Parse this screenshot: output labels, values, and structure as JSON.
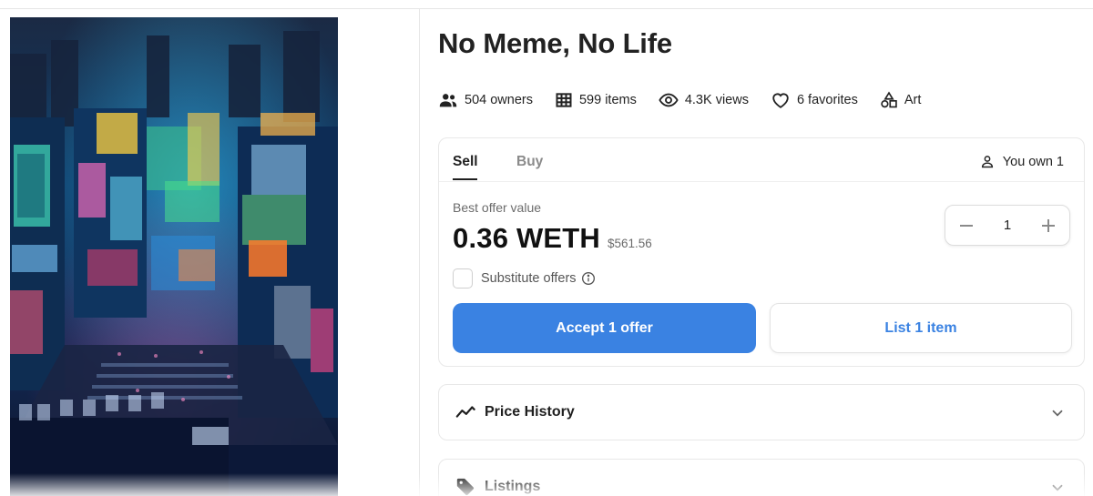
{
  "nft": {
    "title": "No Meme, No Life",
    "artwork_alt": "Neon city street artwork"
  },
  "stats": [
    {
      "icon": "people-icon",
      "label": "504 owners"
    },
    {
      "icon": "grid-icon",
      "label": "599 items"
    },
    {
      "icon": "eye-icon",
      "label": "4.3K views"
    },
    {
      "icon": "heart-icon",
      "label": "6 favorites"
    },
    {
      "icon": "shapes-icon",
      "label": "Art"
    }
  ],
  "trade": {
    "tabs": [
      "Sell",
      "Buy"
    ],
    "active_tab": "Sell",
    "ownership": "You own 1",
    "offer_label": "Best offer value",
    "price": "0.36 WETH",
    "price_usd": "$561.56",
    "quantity": "1",
    "substitute_label": "Substitute offers",
    "accept_label": "Accept 1 offer",
    "list_label": "List 1 item"
  },
  "panels": {
    "price_history": "Price History",
    "listings": "Listings"
  },
  "colors": {
    "accent": "#3a82e2",
    "text": "#1f1f1f",
    "muted": "#6b6b6b",
    "border": "#e8e8e8"
  }
}
